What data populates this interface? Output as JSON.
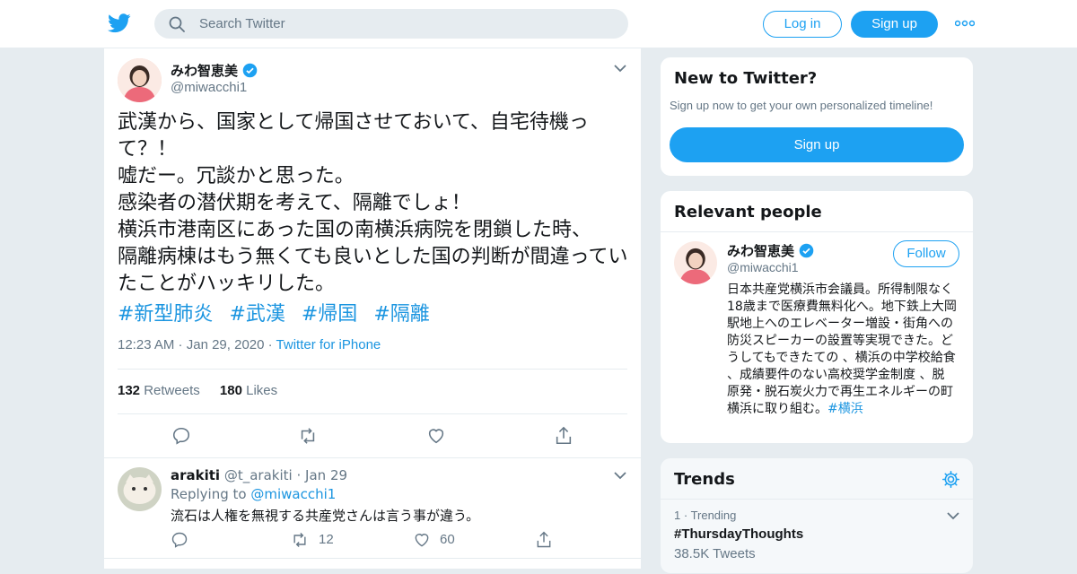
{
  "header": {
    "search_placeholder": "Search Twitter",
    "login_label": "Log in",
    "signup_label": "Sign up",
    "icons": [
      "twitter-logo-icon",
      "search-icon",
      "more-icon"
    ]
  },
  "tweet": {
    "author_name": "みわ智恵美",
    "author_handle": "@miwacchi1",
    "text": "武漢から、国家として帰国させておいて、自宅待機って？！\n嘘だー。冗談かと思った。\n感染者の潜伏期を考えて、隔離でしょ！\n横浜市港南区にあった国の南横浜病院を閉鎖した時、\n隔離病棟はもう無くても良いとした国の判断が間違っていたことがハッキリした。",
    "hashtags": [
      "#新型肺炎",
      "#武漢",
      "#帰国",
      "#隔離"
    ],
    "time": "12:23 AM",
    "date": "Jan 29, 2020",
    "source": "Twitter for iPhone",
    "retweets_count": "132",
    "retweets_label": "Retweets",
    "likes_count": "180",
    "likes_label": "Likes"
  },
  "reply": {
    "name": "arakiti",
    "handle": "@t_arakiti",
    "date": "Jan 29",
    "replying_prefix": "Replying to",
    "replying_to": "@miwacchi1",
    "text": "流石は人権を無視する共産党さんは言う事が違う。",
    "retweets": "12",
    "likes": "60"
  },
  "sidebar": {
    "new_title": "New to Twitter?",
    "new_sub": "Sign up now to get your own personalized timeline!",
    "new_signup": "Sign up",
    "relevant_title": "Relevant people",
    "person_name": "みわ智恵美",
    "person_handle": "@miwacchi1",
    "follow_label": "Follow",
    "person_bio": "日本共産党横浜市会議員。所得制限なく18歳まで医療費無料化へ。地下鉄上大岡駅地上へのエレベーター増設・街角への 防災スピーカーの設置等実現できた。どうしてもできたての 、横浜の中学校給食 、成績要件のない高校奨学金制度 、脱原発・脱石炭火力で再生エネルギーの町横浜に取り組む。",
    "person_bio_tag": "#横浜",
    "trends_title": "Trends",
    "trend_rank": "1",
    "trend_label": "Trending",
    "trend_name": "#ThursdayThoughts",
    "trend_count": "38.5K Tweets"
  },
  "colors": {
    "accent": "#1da1f2",
    "link": "#1b95e0",
    "muted": "#657786",
    "background": "#e6ecf0"
  }
}
